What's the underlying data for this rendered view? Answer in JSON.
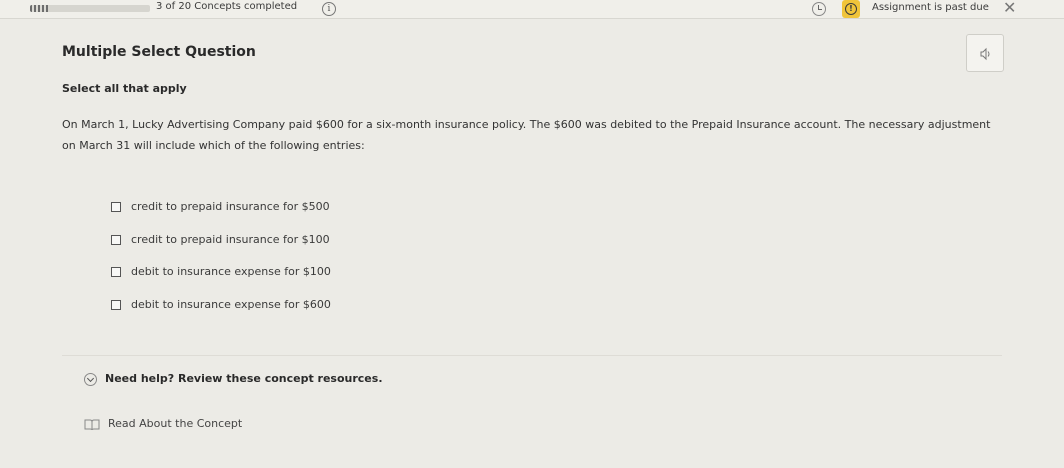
{
  "header": {
    "progress_text": "3 of 20 Concepts completed",
    "progress_fraction": 0.15,
    "info_icon": "info-icon",
    "info_glyph": "i",
    "clock_icon": "clock-icon",
    "alert_icon": "alert-icon",
    "alert_glyph": "!",
    "past_due_text": "Assignment is past due",
    "close_glyph": "✕",
    "alert_color": "#f0c43a"
  },
  "question": {
    "type_label": "Multiple Select Question",
    "instruction": "Select all that apply",
    "prompt": "On March 1, Lucky Advertising Company paid $600 for a six-month insurance policy. The $600 was debited to the Prepaid Insurance account. The necessary adjustment on March 31 will include which of the following entries:",
    "speaker_icon": "speaker-icon",
    "choices": [
      {
        "label": "credit to prepaid insurance for $500",
        "checked": false
      },
      {
        "label": "credit to prepaid insurance for $100",
        "checked": false
      },
      {
        "label": "debit to insurance expense for $100",
        "checked": false
      },
      {
        "label": "debit to insurance expense for $600",
        "checked": false
      }
    ]
  },
  "resources": {
    "help_text": "Need help? Review these concept resources.",
    "help_icon": "chevron-down-icon",
    "read_text": "Read About the Concept",
    "read_icon": "book-icon"
  }
}
